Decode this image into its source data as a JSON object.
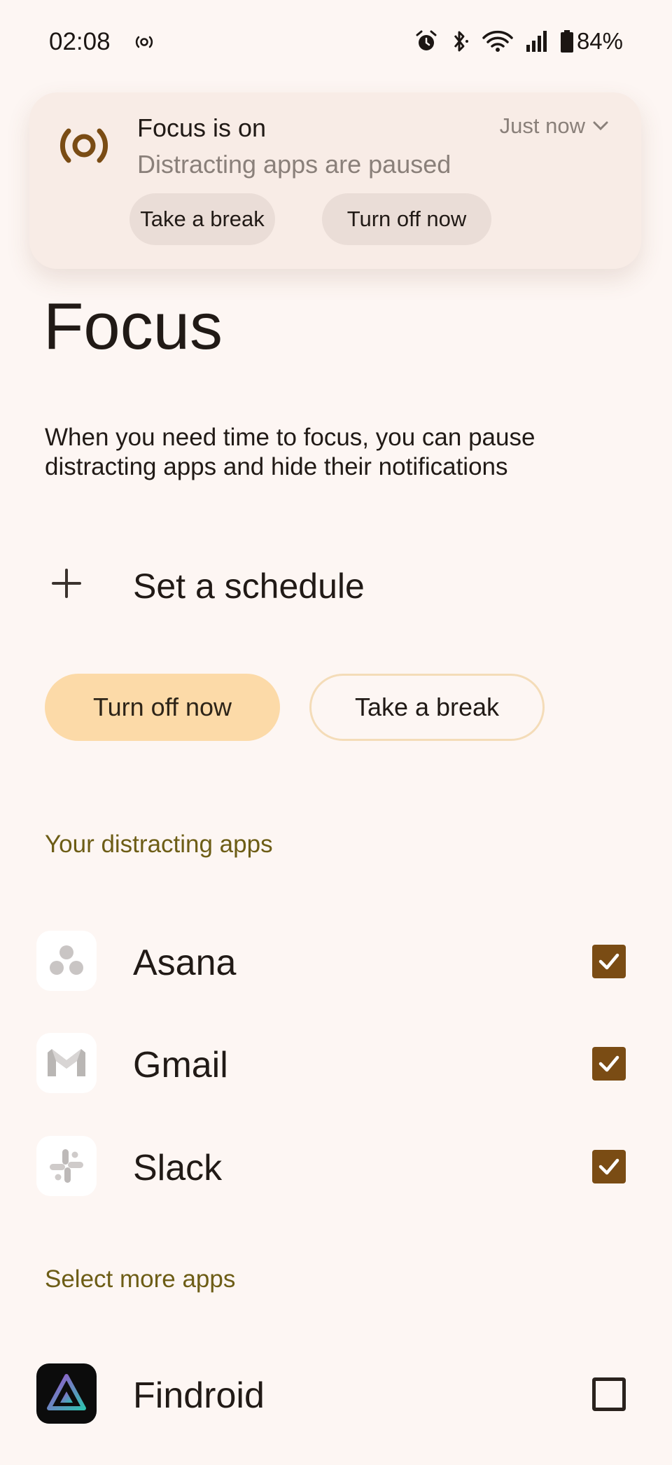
{
  "status_bar": {
    "time": "02:08",
    "battery": "84%",
    "icons": [
      "focus-mode-icon",
      "alarm-icon",
      "bluetooth-icon",
      "wifi-icon",
      "signal-icon",
      "battery-icon"
    ]
  },
  "notification": {
    "title": "Focus is on",
    "subtitle": "Distracting apps are paused",
    "time": "Just now",
    "actions": [
      "Take a break",
      "Turn off now"
    ]
  },
  "page": {
    "title": "Focus",
    "description": "When you need time to focus, you can pause distracting apps and hide their notifications"
  },
  "schedule": {
    "label": "Set a schedule"
  },
  "buttons": {
    "turn_off": "Turn off now",
    "take_break": "Take a break"
  },
  "distracting_apps": {
    "header": "Your distracting apps",
    "items": [
      {
        "name": "Asana",
        "checked": true
      },
      {
        "name": "Gmail",
        "checked": true
      },
      {
        "name": "Slack",
        "checked": true
      }
    ]
  },
  "more_apps": {
    "header": "Select more apps",
    "items": [
      {
        "name": "Findroid",
        "checked": false
      }
    ]
  },
  "colors": {
    "background": "#fdf6f3",
    "accent": "#7a4c14",
    "primary_button": "#fcdaa8",
    "section_title": "#6d5d16"
  }
}
